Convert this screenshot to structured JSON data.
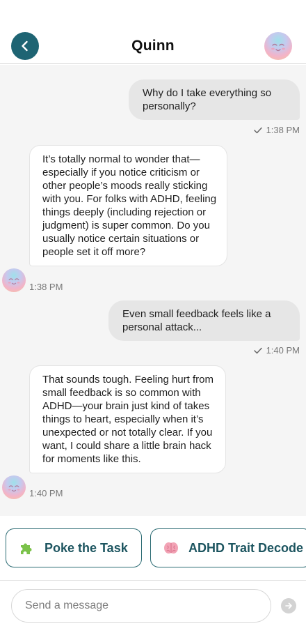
{
  "header": {
    "title": "Quinn",
    "back_icon": "chevron-left-icon",
    "avatar_icon": "smiley-face-icon"
  },
  "messages": [
    {
      "from": "user",
      "text": "Why do I take everything so personally?",
      "time": "1:38 PM",
      "status_icon": "checkmark-icon"
    },
    {
      "from": "bot",
      "text": "It’s totally normal to wonder that—especially if you notice criticism or other people’s moods really sticking with you. For folks with ADHD, feeling things deeply (including rejection or judgment) is super common. Do you usually notice certain situations or people set it off more?",
      "time": "1:38 PM"
    },
    {
      "from": "user",
      "text": "Even small feedback feels like a personal attack...",
      "time": "1:40 PM",
      "status_icon": "checkmark-icon"
    },
    {
      "from": "bot",
      "text": "That sounds tough. Feeling hurt from small feedback is so common with ADHD—your brain just kind of takes things to heart, especially when it’s unexpected or not totally clear. If you want, I could share a little brain hack for moments like this.",
      "time": "1:40 PM"
    }
  ],
  "quick_actions": [
    {
      "label": "Poke the Task",
      "icon": "puzzle-piece-icon"
    },
    {
      "label": "ADHD Trait Decode",
      "icon": "brain-icon"
    }
  ],
  "composer": {
    "placeholder": "Send a message",
    "send_icon": "arrow-right-icon"
  },
  "colors": {
    "accent": "#1e6473",
    "chip_border": "#2b6b73",
    "chat_background": "#f5f5f5",
    "user_bubble": "#e6e6e6",
    "bot_bubble": "#ffffff"
  }
}
